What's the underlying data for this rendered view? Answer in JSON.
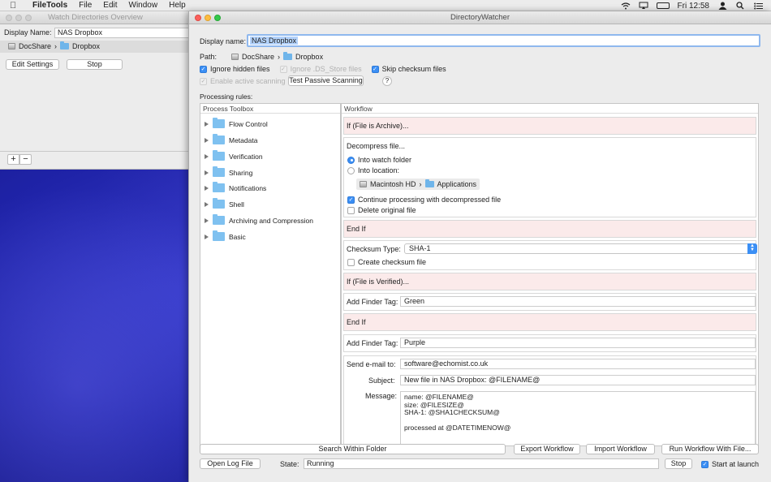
{
  "menubar": {
    "app_name": "FileTools",
    "items": [
      "File",
      "Edit",
      "Window",
      "Help"
    ],
    "clock": "Fri 12:58"
  },
  "overview_window": {
    "title": "Watch Directories Overview",
    "display_name_label": "Display Name:",
    "display_name_value": "NAS Dropbox",
    "path_disk": "DocShare",
    "path_folder": "Dropbox",
    "edit_settings_label": "Edit Settings",
    "stop_label": "Stop",
    "add_label": "+",
    "remove_label": "−"
  },
  "watcher_window": {
    "title": "DirectoryWatcher",
    "display_name_label": "Display name:",
    "display_name_value": "NAS Dropbox",
    "path_label": "Path:",
    "path_disk": "DocShare",
    "path_folder": "Dropbox",
    "ignore_hidden": "Ignore hidden files",
    "ignore_ds_store": "Ignore .DS_Store files",
    "skip_checksum": "Skip checksum files",
    "enable_active": "Enable active scanning",
    "test_passive": "Test Passive Scanning",
    "help": "?",
    "processing_rules": "Processing rules:",
    "toolbox_header": "Process Toolbox",
    "workflow_header": "Workflow",
    "toolbox_items": [
      "Flow Control",
      "Metadata",
      "Verification",
      "Sharing",
      "Notifications",
      "Shell",
      "Archiving and Compression",
      "Basic"
    ],
    "workflow": {
      "if_archive": "If (File is Archive)...",
      "decompress": "Decompress file...",
      "into_watch": "Into watch folder",
      "into_location": "Into location:",
      "loc_disk": "Macintosh HD",
      "loc_folder": "Applications",
      "continue_processing": "Continue processing with decompressed file",
      "delete_original": "Delete original file",
      "end_if_1": "End If",
      "checksum_type_label": "Checksum Type:",
      "checksum_type_value": "SHA-1",
      "create_checksum": "Create checksum file",
      "if_verified": "If (File is Verified)...",
      "add_tag_label_1": "Add Finder Tag:",
      "add_tag_value_1": "Green",
      "end_if_2": "End If",
      "add_tag_label_2": "Add Finder Tag:",
      "add_tag_value_2": "Purple",
      "send_email_label": "Send e-mail to:",
      "send_email_value": "software@echomist.co.uk",
      "subject_label": "Subject:",
      "subject_value": "New file in NAS Dropbox: @FILENAME@",
      "message_label": "Message:",
      "message_lines": [
        "name: @FILENAME@",
        "size: @FILESIZE@",
        "SHA-1: @SHA1CHECKSUM@",
        "",
        "processed at @DATETIMENOW@"
      ]
    },
    "search_within": "Search Within Folder",
    "export_workflow": "Export Workflow",
    "import_workflow": "Import Workflow",
    "run_workflow": "Run Workflow With File...",
    "open_log": "Open Log File",
    "state_label": "State:",
    "state_value": "Running",
    "stop_label": "Stop",
    "start_at_launch": "Start at launch"
  }
}
